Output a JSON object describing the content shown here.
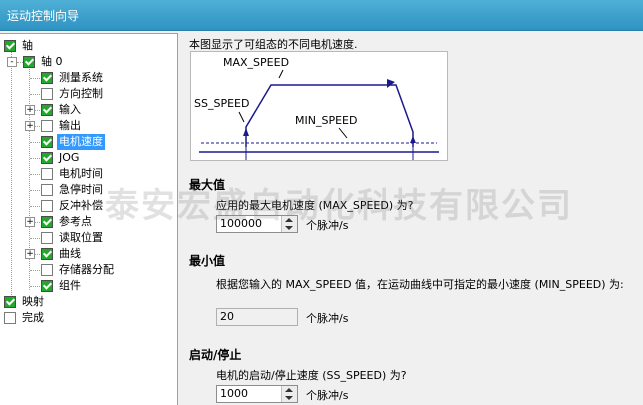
{
  "window": {
    "title": "运动控制向导"
  },
  "tree": {
    "items": [
      {
        "label": "轴",
        "checked": true,
        "expander": ""
      },
      {
        "label": "轴 0",
        "checked": true,
        "expander": "-"
      },
      {
        "label": "测量系统",
        "checked": true,
        "expander": ""
      },
      {
        "label": "方向控制",
        "checked": false,
        "expander": ""
      },
      {
        "label": "输入",
        "checked": true,
        "expander": "+"
      },
      {
        "label": "输出",
        "checked": false,
        "expander": "+"
      },
      {
        "label": "电机速度",
        "checked": true,
        "expander": "",
        "selected": true
      },
      {
        "label": "JOG",
        "checked": true,
        "expander": ""
      },
      {
        "label": "电机时间",
        "checked": false,
        "expander": ""
      },
      {
        "label": "急停时间",
        "checked": false,
        "expander": ""
      },
      {
        "label": "反冲补偿",
        "checked": false,
        "expander": ""
      },
      {
        "label": "参考点",
        "checked": true,
        "expander": "+"
      },
      {
        "label": "读取位置",
        "checked": false,
        "expander": ""
      },
      {
        "label": "曲线",
        "checked": true,
        "expander": "+"
      },
      {
        "label": "存储器分配",
        "checked": false,
        "expander": ""
      },
      {
        "label": "组件",
        "checked": true,
        "expander": ""
      },
      {
        "label": "映射",
        "checked": true,
        "expander": ""
      },
      {
        "label": "完成",
        "checked": false,
        "expander": ""
      }
    ]
  },
  "content": {
    "description": "本图显示了可组态的不同电机速度.",
    "diagram": {
      "max_label": "MAX_SPEED",
      "ss_label": "SS_SPEED",
      "min_label": "MIN_SPEED"
    },
    "max_section": {
      "title": "最大值",
      "question": "应用的最大电机速度 (MAX_SPEED) 为?",
      "value": "100000",
      "unit": "个脉冲/s"
    },
    "min_section": {
      "title": "最小值",
      "question": "根据您输入的 MAX_SPEED 值，在运动曲线中可指定的最小速度 (MIN_SPEED) 为:",
      "value": "20",
      "unit": "个脉冲/s"
    },
    "startstop_section": {
      "title": "启动/停止",
      "question": "电机的启动/停止速度 (SS_SPEED) 为?",
      "value": "1000",
      "unit": "个脉冲/s"
    }
  },
  "watermark": "泰安宏盛自动化科技有限公司",
  "colors": {
    "titlebar": "#2f93c2",
    "checkbox": "#22a82a",
    "selection": "#3399ff"
  }
}
